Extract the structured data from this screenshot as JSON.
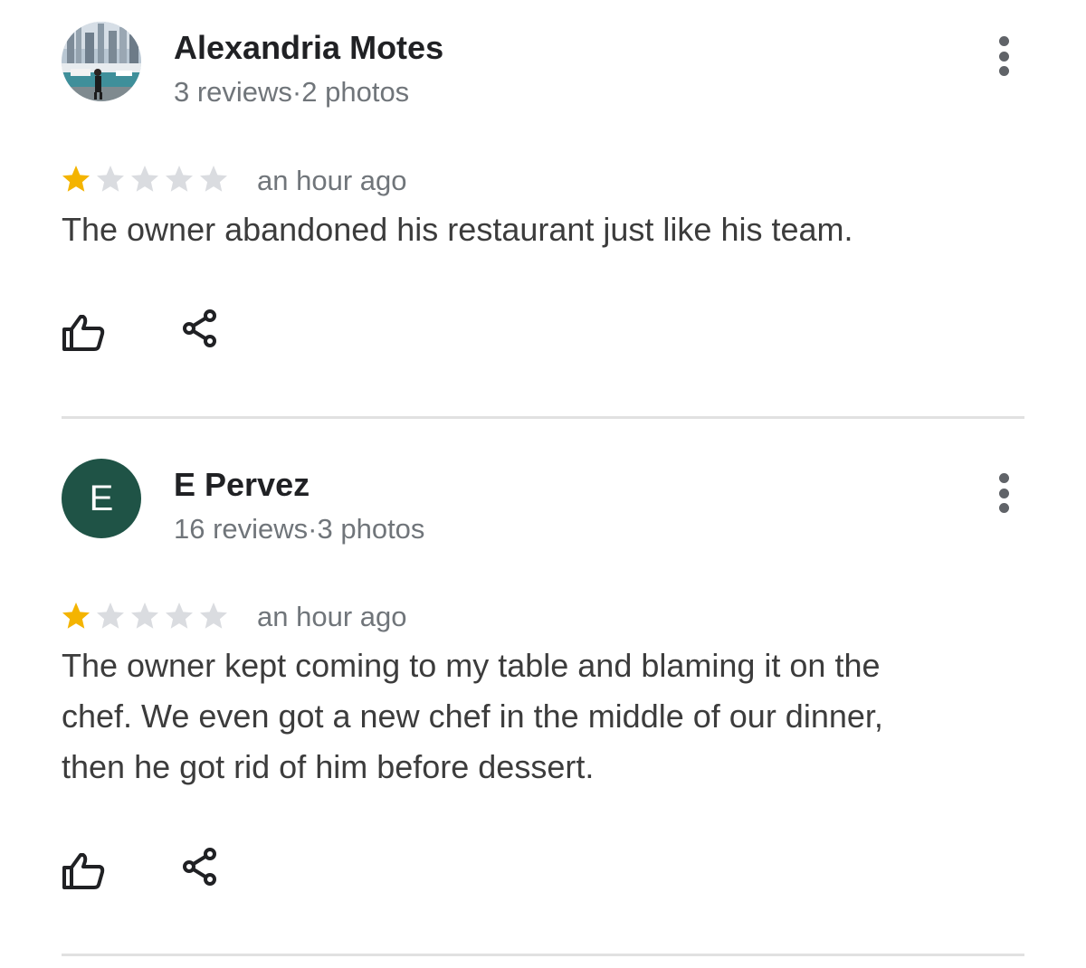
{
  "reviews": [
    {
      "author": "Alexandria Motes",
      "stats": "3 reviews·2 photos",
      "rating": 1,
      "max_rating": 5,
      "time": "an hour ago",
      "text": "The owner abandoned his restaurant just like his team.",
      "avatar_type": "photo"
    },
    {
      "author": "E Pervez",
      "avatar_letter": "E",
      "avatar_color": "#1f5346",
      "stats": "16 reviews·3 photos",
      "rating": 1,
      "max_rating": 5,
      "time": "an hour ago",
      "text": "The owner kept coming to my table and blaming it on the chef. We even got a new chef in the middle of our dinner, then he got rid of him before dessert.",
      "avatar_type": "letter"
    }
  ],
  "colors": {
    "star_filled": "#f4b400",
    "star_empty": "#dadce0",
    "divider": "#e1e1e1"
  },
  "icons": [
    "more-vert-icon",
    "star-icon",
    "thumb-up-icon",
    "share-icon"
  ]
}
